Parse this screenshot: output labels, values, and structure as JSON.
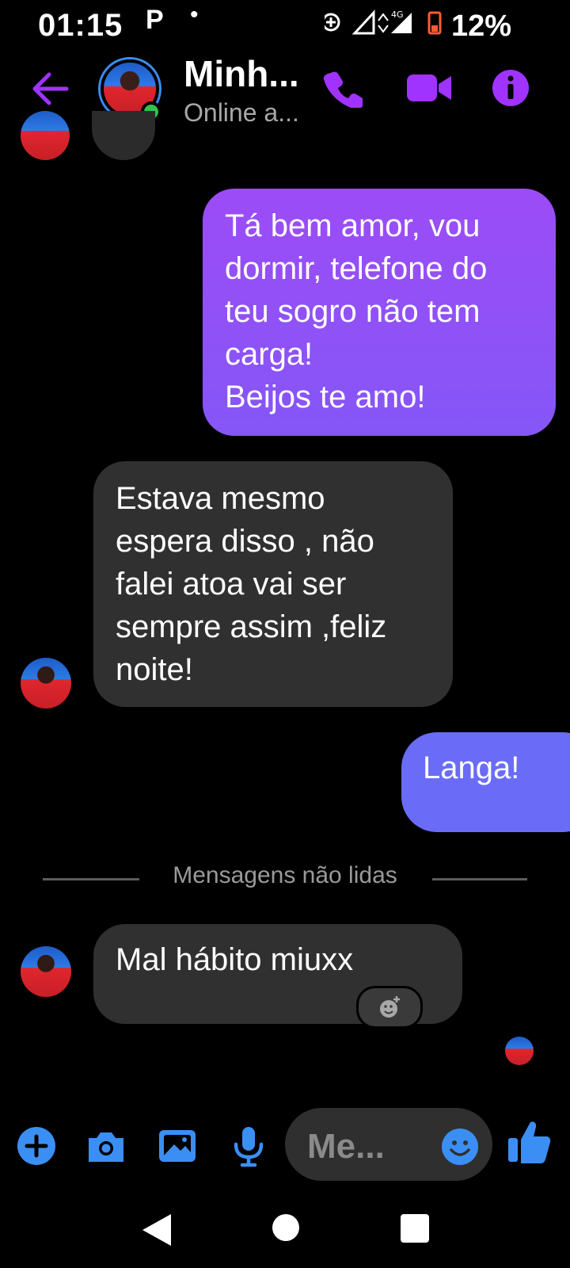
{
  "status_bar": {
    "time": "01:15",
    "notification": "P",
    "dot": "•",
    "network": "4G",
    "battery_percent": "12%"
  },
  "header": {
    "contact_name": "Minh...",
    "contact_status": "Online a...",
    "icons": [
      "back-arrow-icon",
      "phone-icon",
      "video-camera-icon",
      "info-icon"
    ],
    "accent_color": "#a033ff"
  },
  "messages": [
    {
      "sender": "me",
      "text": "Tá bem amor, vou\ndormir, telefone do\nteu sogro não tem\ncarga!\nBeijos te amo!"
    },
    {
      "sender": "contact",
      "text": "Estava mesmo\nespera disso , não\nfalei atoa vai ser\nsempre assim ,feliz\nnoite!"
    },
    {
      "sender": "me",
      "text": "Langa!"
    },
    {
      "sender": "contact",
      "text": "Mal hábito miuxx"
    }
  ],
  "divider": {
    "label": "Mensagens não lidas"
  },
  "composer": {
    "placeholder": "Me...",
    "icons": [
      "add-icon",
      "camera-icon",
      "gallery-icon",
      "microphone-icon",
      "emoji-icon",
      "thumbs-up-icon"
    ],
    "icon_color": "#3b8ff4"
  },
  "colors": {
    "sent_bubble_top": "#9c4cf6",
    "sent_bubble_bottom": "#6a6cf8",
    "received_bubble": "#303030",
    "online": "#31c24d"
  }
}
